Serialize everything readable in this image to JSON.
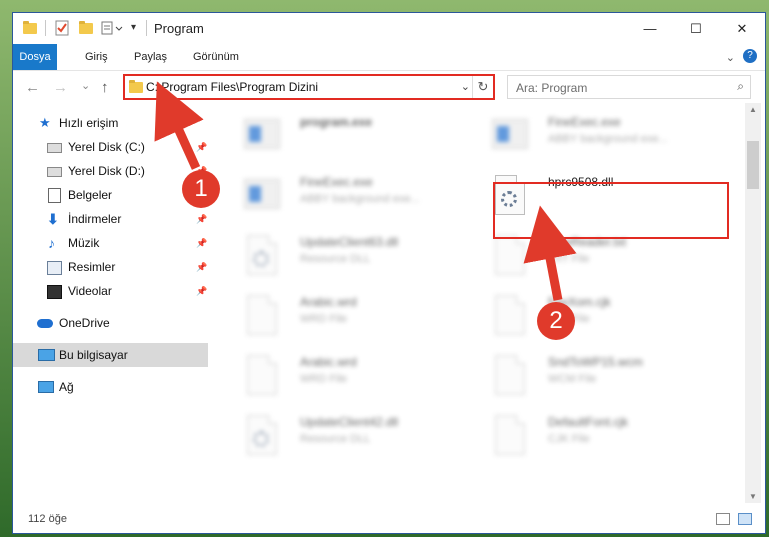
{
  "window": {
    "title": "Program",
    "controls": {
      "minimize": "—",
      "maximize": "☐",
      "close": "✕"
    }
  },
  "ribbon": {
    "tabs": [
      {
        "label": "Dosya",
        "active": true
      },
      {
        "label": "Giriş",
        "active": false
      },
      {
        "label": "Paylaş",
        "active": false
      },
      {
        "label": "Görünüm",
        "active": false
      }
    ],
    "help": "?"
  },
  "navigation": {
    "back": "←",
    "forward": "→",
    "recent": "⌄",
    "up": "↑",
    "address": "C:\\Program Files\\Program Dizini",
    "dropdown": "⌄",
    "refresh": "↻"
  },
  "search": {
    "placeholder": "Ara: Program",
    "icon": "⌕"
  },
  "sidebar": {
    "items": [
      {
        "label": "Hızlı erişim",
        "icon": "star-icon",
        "pinned": false
      },
      {
        "label": "Yerel Disk (C:)",
        "icon": "drive-icon",
        "pinned": true
      },
      {
        "label": "Yerel Disk (D:)",
        "icon": "drive-icon",
        "pinned": true
      },
      {
        "label": "Belgeler",
        "icon": "documents-icon",
        "pinned": true
      },
      {
        "label": "İndirmeler",
        "icon": "download-icon",
        "pinned": true
      },
      {
        "label": "Müzik",
        "icon": "music-icon",
        "pinned": true
      },
      {
        "label": "Resimler",
        "icon": "pictures-icon",
        "pinned": true
      },
      {
        "label": "Videolar",
        "icon": "videos-icon",
        "pinned": true
      },
      {
        "label": "OneDrive",
        "icon": "cloud-icon",
        "pinned": false
      },
      {
        "label": "Bu bilgisayar",
        "icon": "computer-icon",
        "pinned": false,
        "selected": true
      },
      {
        "label": "Ağ",
        "icon": "network-icon",
        "pinned": false
      }
    ]
  },
  "files": [
    {
      "name": "program.exe",
      "desc": "",
      "kind": "exe",
      "blurred": true
    },
    {
      "name": "FineExec.exe",
      "desc": "ABBY background exe...",
      "kind": "exe",
      "blurred": true
    },
    {
      "name": "FineExec.exe",
      "desc": "ABBY background exe...",
      "kind": "exe",
      "blurred": true
    },
    {
      "name": "hprc9508.dll",
      "desc": "",
      "kind": "dll",
      "blurred": false
    },
    {
      "name": "UpdateClient63.dll",
      "desc": "Resource DLL",
      "kind": "dll",
      "blurred": true
    },
    {
      "name": "FineReader.txt",
      "desc": "TXT File",
      "kind": "doc",
      "blurred": true
    },
    {
      "name": "Arabic.wrd",
      "desc": "WRD File",
      "kind": "doc",
      "blurred": true
    },
    {
      "name": "FaxXom.cjk",
      "desc": "CJK File",
      "kind": "doc",
      "blurred": true
    },
    {
      "name": "Arabic.wrd",
      "desc": "WRD File",
      "kind": "doc",
      "blurred": true
    },
    {
      "name": "SndToWP15.wcm",
      "desc": "WCM File",
      "kind": "doc",
      "blurred": true
    },
    {
      "name": "UpdateClient42.dll",
      "desc": "Resource DLL",
      "kind": "dll",
      "blurred": true
    },
    {
      "name": "DefaultFont.cjk",
      "desc": "CJK File",
      "kind": "doc",
      "blurred": true
    }
  ],
  "annotations": {
    "badge1": "1",
    "badge2": "2",
    "color": "#e03a2b"
  },
  "status": {
    "item_count": "112 öğe"
  }
}
